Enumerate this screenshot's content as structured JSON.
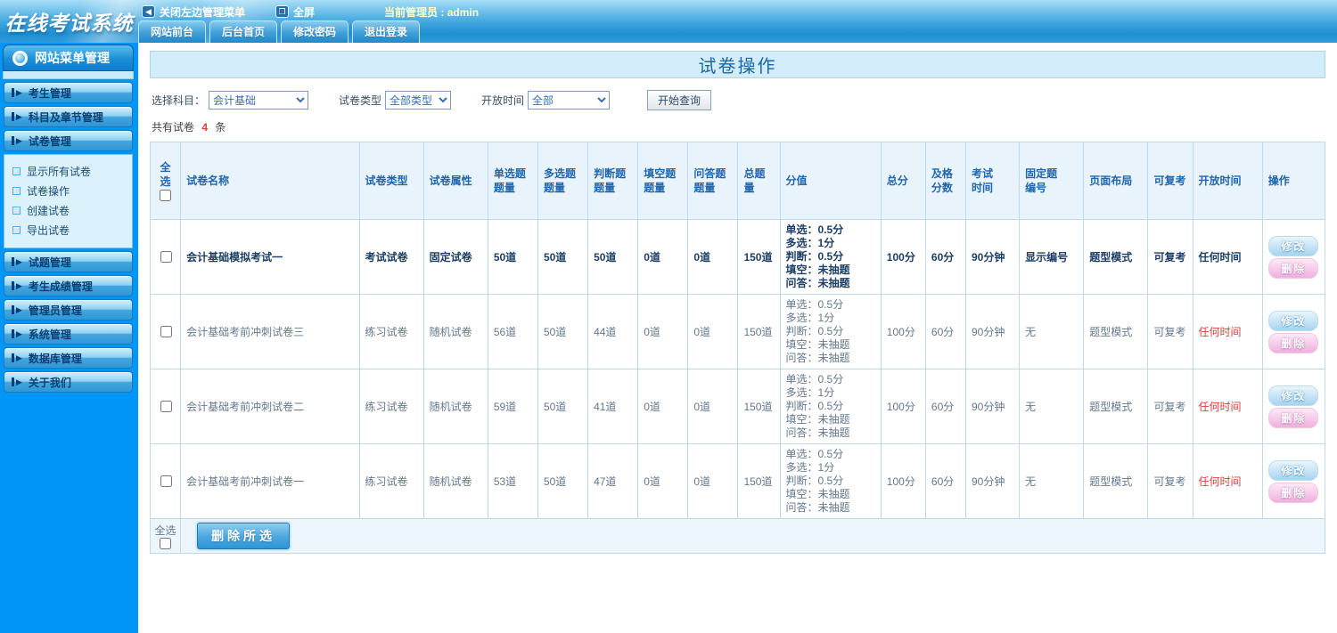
{
  "header": {
    "logo": "在线考试系统",
    "toolbar": {
      "collapse_label": "关闭左边管理菜单",
      "fullscreen_label": "全屏",
      "admin_label": "当前管理员 : admin"
    },
    "tabs": [
      "网站前台",
      "后台首页",
      "修改密码",
      "退出登录"
    ]
  },
  "icons": {
    "collapse": "◀",
    "fullscreen": "❐",
    "menu_arrow": "▶"
  },
  "colors": {
    "sidebar_blue": "#0096f8",
    "accent_blue": "#1f66ad",
    "alert_red": "#e03a3a"
  },
  "sidebar": {
    "title": "网站菜单管理",
    "groups": [
      {
        "label": "考生管理"
      },
      {
        "label": "科目及章节管理"
      },
      {
        "label": "试卷管理",
        "children": [
          "显示所有试卷",
          "试卷操作",
          "创建试卷",
          "导出试卷"
        ]
      },
      {
        "label": "试题管理"
      },
      {
        "label": "考生成绩管理"
      },
      {
        "label": "管理员管理"
      },
      {
        "label": "系统管理"
      },
      {
        "label": "数据库管理"
      },
      {
        "label": "关于我们"
      }
    ]
  },
  "main": {
    "page_title": "试卷操作",
    "filters": {
      "subject_label": "选择科目：",
      "subject_value": "会计基础",
      "type_label": "试卷类型",
      "type_value": "全部类型",
      "time_label": "开放时间",
      "time_value": "全部",
      "search_button": "开始查询"
    },
    "summary": {
      "prefix": "共有试卷",
      "count": "4",
      "suffix": "条"
    },
    "table": {
      "headers": [
        "全选",
        "试卷名称",
        "试卷类型",
        "试卷属性",
        "单选题\n题量",
        "多选题\n题量",
        "判断题\n题量",
        "填空题\n题量",
        "问答题\n题量",
        "总题量",
        "分值",
        "总分",
        "及格\n分数",
        "考试\n时间",
        "固定题\n编号",
        "页面布局",
        "可复考",
        "开放时间",
        "操作"
      ],
      "rows": [
        {
          "bold": true,
          "name": "会计基础模拟考试一",
          "type": "考试试卷",
          "attr": "固定试卷",
          "single": "50道",
          "multi": "50道",
          "judge": "50道",
          "blank": "0道",
          "qa": "0道",
          "total_q": "150道",
          "score_lines": [
            "单选：0.5分",
            "多选：1分",
            "判断：0.5分",
            "填空：未抽题",
            "问答：未抽题"
          ],
          "total_score": "100分",
          "pass_score": "60分",
          "duration": "90分钟",
          "fixed_no": "显示编号",
          "layout": "题型模式",
          "retake": "可复考",
          "open_time": "任何时间"
        },
        {
          "bold": false,
          "name": "会计基础考前冲刺试卷三",
          "type": "练习试卷",
          "attr": "随机试卷",
          "single": "56道",
          "multi": "50道",
          "judge": "44道",
          "blank": "0道",
          "qa": "0道",
          "total_q": "150道",
          "score_lines": [
            "单选：0.5分",
            "多选：1分",
            "判断：0.5分",
            "填空：未抽题",
            "问答：未抽题"
          ],
          "total_score": "100分",
          "pass_score": "60分",
          "duration": "90分钟",
          "fixed_no": "无",
          "layout": "题型模式",
          "retake": "可复考",
          "open_time": "任何时间"
        },
        {
          "bold": false,
          "name": "会计基础考前冲刺试卷二",
          "type": "练习试卷",
          "attr": "随机试卷",
          "single": "59道",
          "multi": "50道",
          "judge": "41道",
          "blank": "0道",
          "qa": "0道",
          "total_q": "150道",
          "score_lines": [
            "单选：0.5分",
            "多选：1分",
            "判断：0.5分",
            "填空：未抽题",
            "问答：未抽题"
          ],
          "total_score": "100分",
          "pass_score": "60分",
          "duration": "90分钟",
          "fixed_no": "无",
          "layout": "题型模式",
          "retake": "可复考",
          "open_time": "任何时间"
        },
        {
          "bold": false,
          "name": "会计基础考前冲刺试卷一",
          "type": "练习试卷",
          "attr": "随机试卷",
          "single": "53道",
          "multi": "50道",
          "judge": "47道",
          "blank": "0道",
          "qa": "0道",
          "total_q": "150道",
          "score_lines": [
            "单选：0.5分",
            "多选：1分",
            "判断：0.5分",
            "填空：未抽题",
            "问答：未抽题"
          ],
          "total_score": "100分",
          "pass_score": "60分",
          "duration": "90分钟",
          "fixed_no": "无",
          "layout": "题型模式",
          "retake": "可复考",
          "open_time": "任何时间"
        }
      ],
      "actions": {
        "edit": "修改",
        "delete": "删除"
      },
      "footer": {
        "select_all": "全选",
        "delete_selected": "删除所选"
      }
    }
  }
}
